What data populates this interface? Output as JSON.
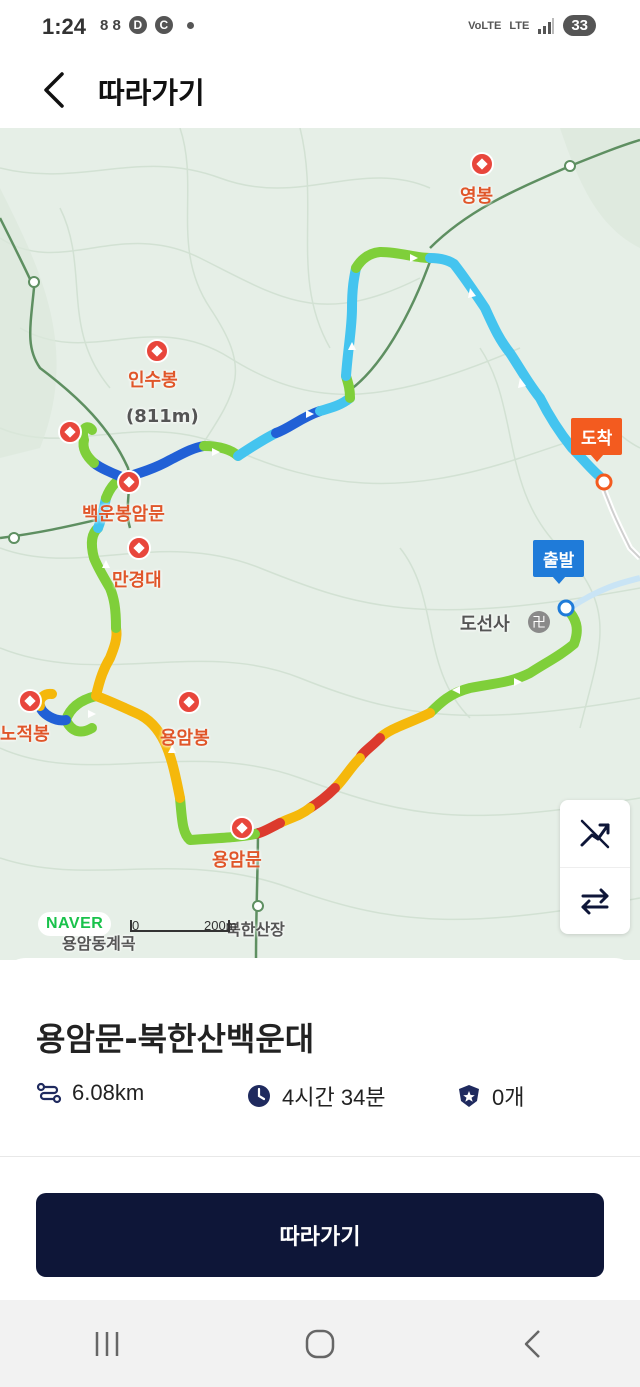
{
  "status_bar": {
    "time": "1:24",
    "left_icons": [
      "8 8",
      "D",
      "C"
    ],
    "network": "LTE",
    "volte": "VoLTE",
    "battery": "33"
  },
  "header": {
    "title": "따라가기",
    "back_icon": "chevron-left-icon"
  },
  "map": {
    "pois": [
      {
        "name": "영봉",
        "type": "peak"
      },
      {
        "name": "인수봉",
        "type": "peak"
      },
      {
        "name": "(811m)",
        "type": "elevation"
      },
      {
        "name": "백운봉암문",
        "type": "gate"
      },
      {
        "name": "만경대",
        "type": "peak"
      },
      {
        "name": "노적봉",
        "type": "peak"
      },
      {
        "name": "용암봉",
        "type": "peak"
      },
      {
        "name": "용암문",
        "type": "gate"
      },
      {
        "name": "도선사",
        "type": "temple"
      },
      {
        "name": "북한산장",
        "type": "hut"
      },
      {
        "name": "용암동계곡",
        "type": "valley"
      }
    ],
    "arrive_label": "도착",
    "depart_label": "출발",
    "brand": "NAVER",
    "scale_start": "0",
    "scale_end": "200m",
    "controls": [
      {
        "name": "route-toggle",
        "icon": "route-slash-icon"
      },
      {
        "name": "swap",
        "icon": "swap-arrows-icon"
      }
    ],
    "route_colors": {
      "green": "#7fcf3a",
      "yellow": "#f5b80b",
      "red": "#dc3a2d",
      "sky": "#44c4ef",
      "blue": "#2160d6"
    }
  },
  "sheet": {
    "title": "용암문-북한산백운대",
    "distance": "6.08km",
    "duration": "4시간 34분",
    "count": "0개",
    "follow_label": "따라가기"
  },
  "nav_bar": {
    "buttons": [
      "recent-apps-icon",
      "home-icon",
      "back-icon"
    ]
  }
}
